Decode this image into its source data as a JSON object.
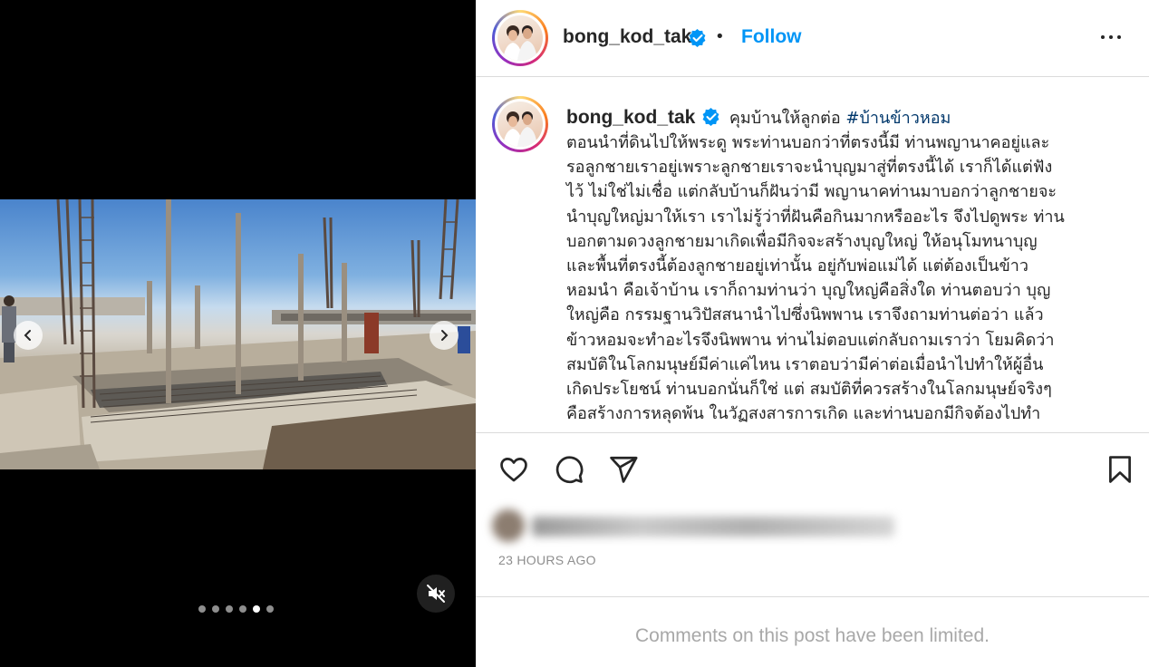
{
  "post": {
    "username": "bong_kod_tak",
    "follow_label": "Follow",
    "separator": "•",
    "more_label": "More options",
    "caption_title": "คุมบ้านให้ลูกต่อ",
    "hashtag": "#บ้านข้าวหอม",
    "caption_lines": [
      "ตอนนำที่ดินไปให้พระดู พระท่านบอกว่าที่ตรงนี้มี ท่านพญานาคอยู่และ",
      "รอลูกชายเราอยู่เพราะลูกชายเราจะนำบุญมาสู่ที่ตรงนี้ได้ เราก็ได้แต่ฟัง",
      "ไว้ ไม่ใช่ไม่เชื่อ แต่กลับบ้านก็ฝันว่ามี พญานาคท่านมาบอกว่าลูกชายจะ",
      "นำบุญใหญ่มาให้เรา เราไม่รู้ว่าที่ฝันคือกินมากหรืออะไร จึงไปดูพระ ท่าน",
      "บอกตามดวงลูกชายมาเกิดเพื่อมีกิจจะสร้างบุญใหญ่ ให้อนุโมทนาบุญ",
      "และพื้นที่ตรงนี้ต้องลูกชายอยู่เท่านั้น อยู่กับพ่อแม่ได้ แต่ต้องเป็นข้าว",
      "หอมนำ คือเจ้าบ้าน เราก็ถามท่านว่า บุญใหญ่คือสิ่งใด ท่านตอบว่า บุญ",
      "ใหญ่คือ กรรมฐานวิปัสสนานำไปซึ่งนิพพาน เราจึงถามท่านต่อว่า แล้ว",
      "ข้าวหอมจะทำอะไรจึงนิพพาน ท่านไม่ตอบแต่กลับถามเราว่า โยมคิดว่า",
      "สมบัติในโลกมนุษย์มีค่าแค่ไหน เราตอบว่ามีค่าต่อเมื่อนำไปทำให้ผู้อื่น",
      "เกิดประโยชน์ ท่านบอกนั่นก็ใช่ แต่ สมบัติที่ควรสร้างในโลกมนุษย์จริงๆ",
      "คือสร้างการหลุดพ้น ในวัฏสงสารการเกิด และท่านบอกมีกิจต้องไปทำ"
    ],
    "timestamp": "23 HOURS AGO",
    "comments_limited": "Comments on this post have been limited.",
    "carousel": {
      "count": 6,
      "active_index": 4
    }
  },
  "colors": {
    "accent": "#0095f6",
    "hashtag": "#00376b",
    "muted": "#8e8e8e",
    "border": "#dbdbdb"
  },
  "icons": {
    "verified": "verified-badge-icon",
    "like": "heart-icon",
    "comment": "comment-icon",
    "share": "paper-plane-icon",
    "save": "bookmark-icon",
    "mute": "speaker-muted-icon",
    "prev": "chevron-left-icon",
    "next": "chevron-right-icon"
  }
}
